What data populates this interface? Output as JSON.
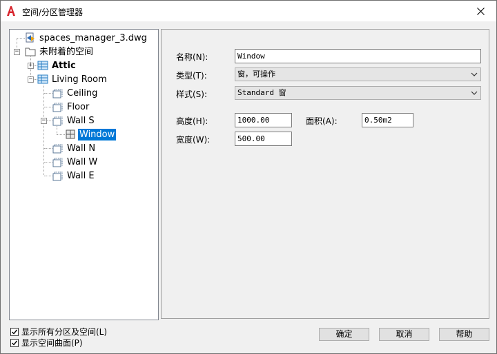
{
  "window": {
    "title": "空间/分区管理器"
  },
  "tree": {
    "root_file": "spaces_manager_3.dwg",
    "unattached": "未附着的空间",
    "attic": "Attic",
    "living_room": "Living Room",
    "ceiling": "Ceiling",
    "floor": "Floor",
    "wall_s": "Wall S",
    "window": "Window",
    "wall_n": "Wall N",
    "wall_w": "Wall W",
    "wall_e": "Wall E"
  },
  "properties": {
    "name_label": "名称(N):",
    "name_value": "Window",
    "type_label": "类型(T):",
    "type_value": "窗，可操作",
    "style_label": "样式(S):",
    "style_value": "Standard 窗",
    "height_label": "高度(H):",
    "height_value": "1000.00",
    "area_label": "面积(A):",
    "area_value": "0.50m2",
    "width_label": "宽度(W):",
    "width_value": "500.00"
  },
  "options": {
    "show_all_zones": "显示所有分区及空间(L)",
    "show_all_zones_checked": true,
    "show_surfaces": "显示空间曲面(P)",
    "show_surfaces_checked": true
  },
  "buttons": {
    "ok": "确定",
    "cancel": "取消",
    "help": "帮助"
  }
}
